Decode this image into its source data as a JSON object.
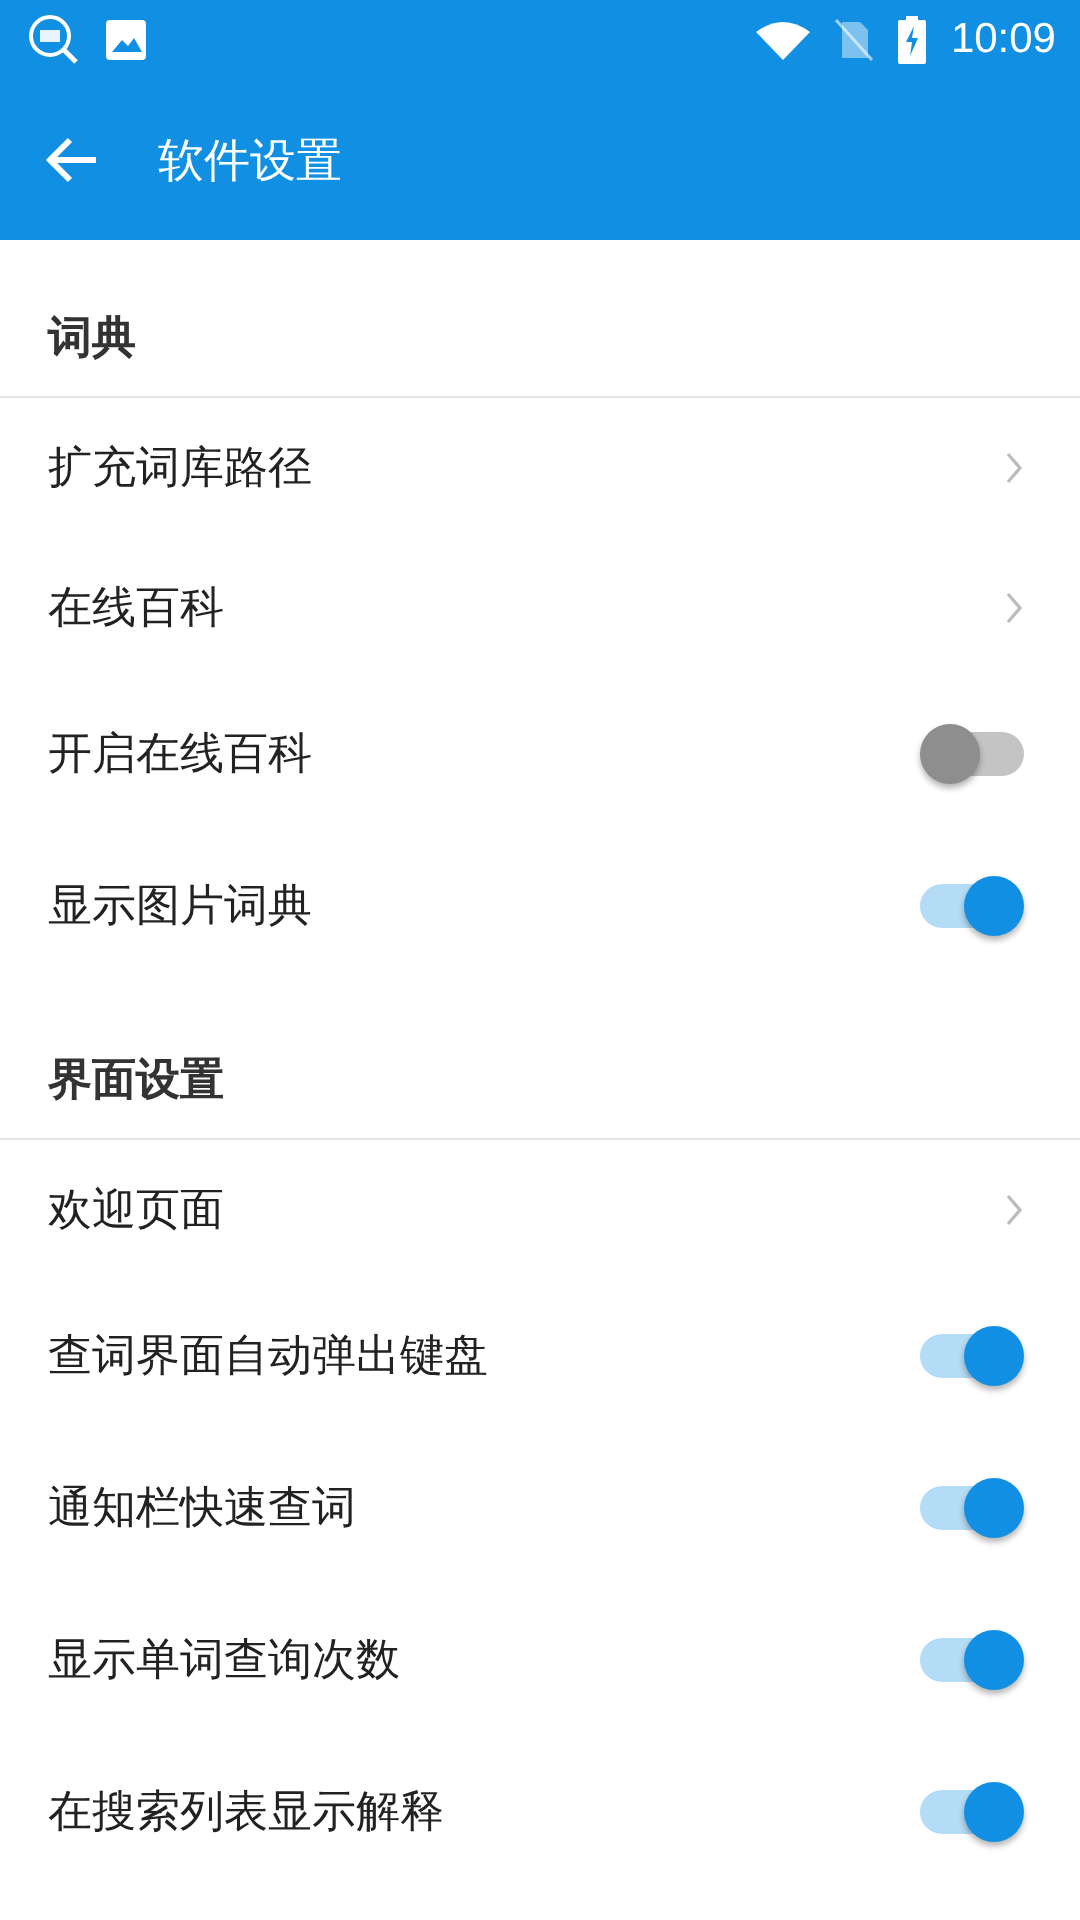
{
  "status_bar": {
    "time": "10:09"
  },
  "app_bar": {
    "title": "软件设置"
  },
  "sections": [
    {
      "title": "词典",
      "items": [
        {
          "kind": "link",
          "label": "扩充词库路径"
        },
        {
          "kind": "link",
          "label": "在线百科"
        },
        {
          "kind": "switch",
          "label": "开启在线百科",
          "on": false
        },
        {
          "kind": "switch",
          "label": "显示图片词典",
          "on": true
        }
      ]
    },
    {
      "title": "界面设置",
      "items": [
        {
          "kind": "link",
          "label": "欢迎页面"
        },
        {
          "kind": "switch",
          "label": "查词界面自动弹出键盘",
          "on": true
        },
        {
          "kind": "switch",
          "label": "通知栏快速查词",
          "on": true
        },
        {
          "kind": "switch",
          "label": "显示单词查询次数",
          "on": true
        },
        {
          "kind": "switch",
          "label": "在搜索列表显示解释",
          "on": true
        }
      ]
    }
  ]
}
